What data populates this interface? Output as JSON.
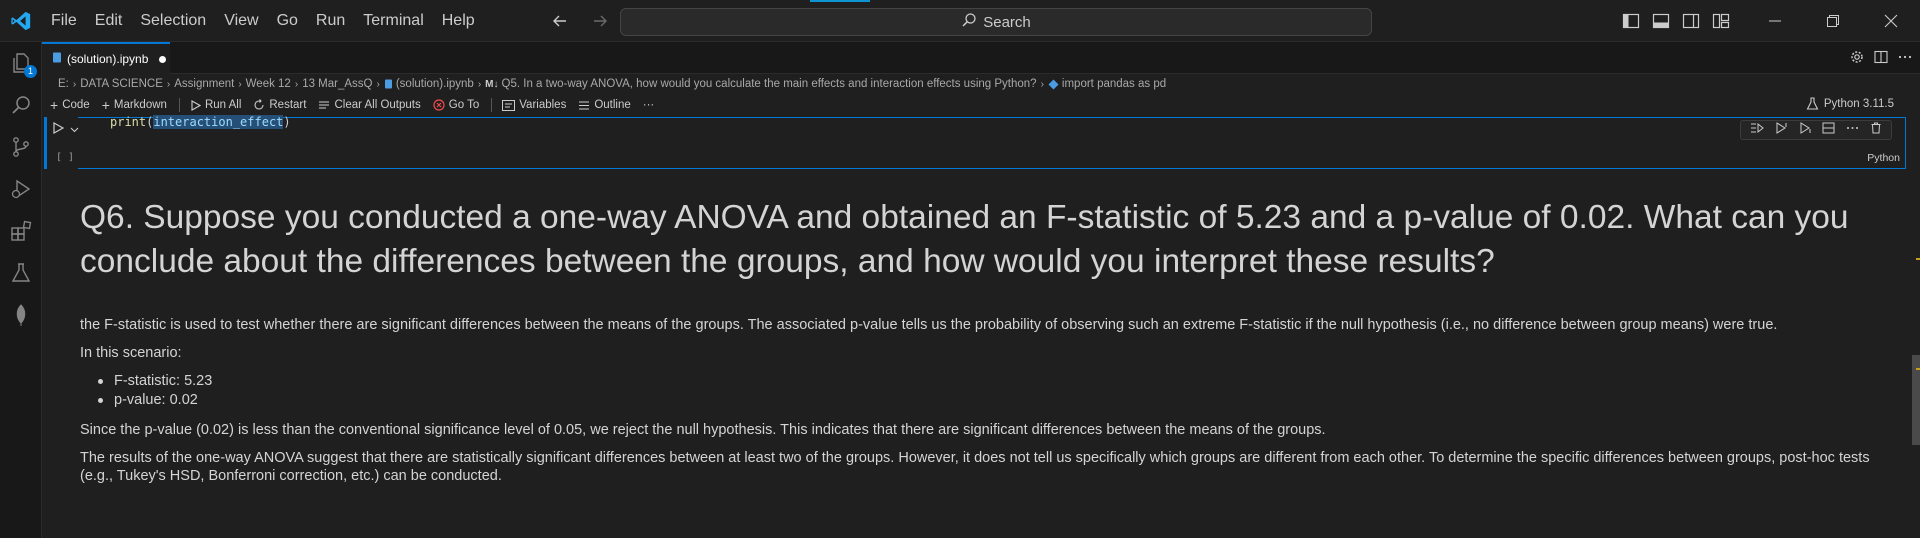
{
  "titlebar": {
    "menu": [
      "File",
      "Edit",
      "Selection",
      "View",
      "Go",
      "Run",
      "Terminal",
      "Help"
    ],
    "search_label": "Search"
  },
  "activity": {
    "explorer_badge": "1"
  },
  "tab": {
    "label": "(solution).ipynb"
  },
  "breadcrumb": {
    "items": [
      "E:",
      "DATA SCIENCE",
      "Assignment",
      "Week 12",
      "13 Mar_AssQ",
      "(solution).ipynb",
      "Q5. In a two-way ANOVA, how would you calculate the main effects and interaction effects using Python?",
      "import pandas as pd"
    ],
    "md_prefix": "M↓"
  },
  "toolbar": {
    "code": "Code",
    "markdown": "Markdown",
    "run_all": "Run All",
    "restart": "Restart",
    "clear_outputs": "Clear All Outputs",
    "go_to": "Go To",
    "variables": "Variables",
    "outline": "Outline",
    "more": "···",
    "kernel": "Python 3.11.5"
  },
  "cell": {
    "code_fn": "print",
    "code_open": "(",
    "code_var": "interaction_effect",
    "code_close": ")",
    "exec_count": "[ ]",
    "language": "Python"
  },
  "markdown": {
    "heading": "Q6. Suppose you conducted a one-way ANOVA and obtained an F-statistic of 5.23 and a p-value of 0.02. What can you conclude about the differences between the groups, and how would you interpret these results?",
    "p1": "the F-statistic is used to test whether there are significant differences between the means of the groups. The associated p-value tells us the probability of observing such an extreme F-statistic if the null hypothesis (i.e., no difference between group means) were true.",
    "p2": "In this scenario:",
    "bullets": [
      "F-statistic: 5.23",
      "p-value: 0.02"
    ],
    "p3": "Since the p-value (0.02) is less than the conventional significance level of 0.05, we reject the null hypothesis. This indicates that there are significant differences between the means of the groups.",
    "p4": "The results of the one-way ANOVA suggest that there are statistically significant differences between at least two of the groups. However, it does not tell us specifically which groups are different from each other. To determine the specific differences between groups, post-hoc tests (e.g., Tukey's HSD, Bonferroni correction, etc.) can be conducted."
  },
  "colors": {
    "accent": "#0078d4",
    "logo": "#23a9f2",
    "background": "#1f1f1f",
    "text": "#d4d4d4"
  }
}
